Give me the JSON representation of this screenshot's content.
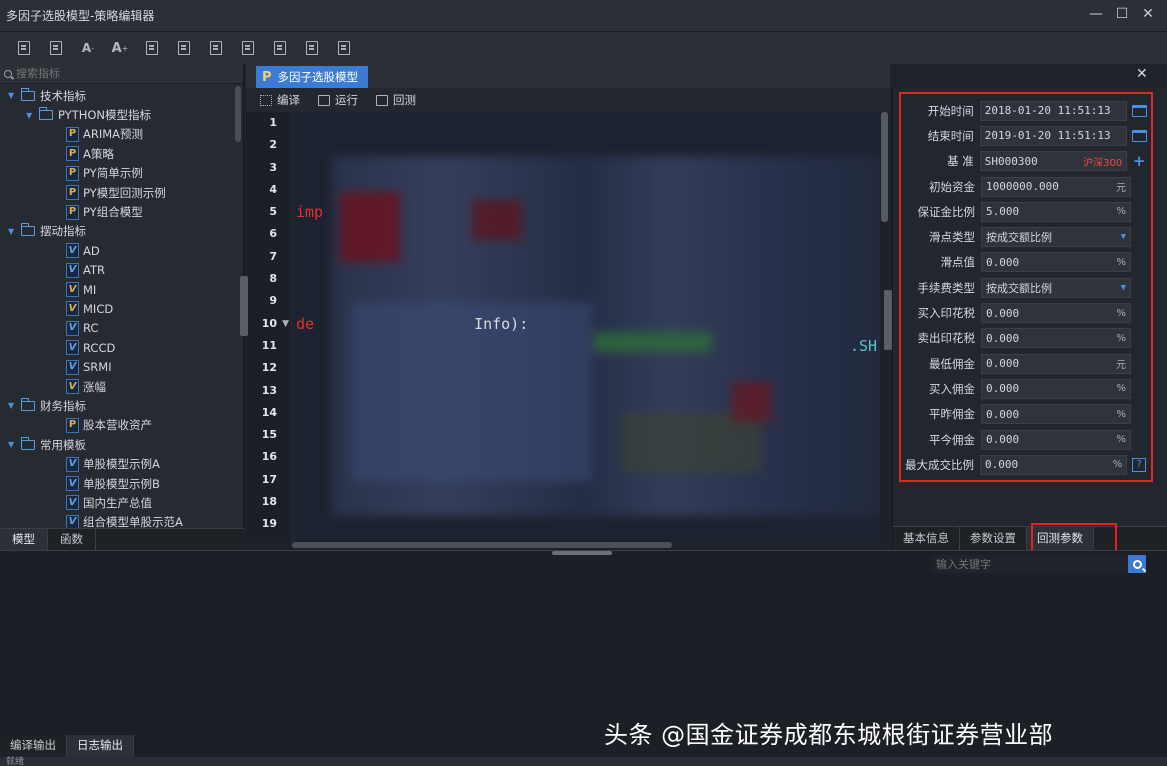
{
  "window": {
    "title": "多因子选股模型-策略编辑器",
    "controls": [
      "—",
      "☐",
      "✕"
    ]
  },
  "toolbar": {
    "buttons": [
      "new-file",
      "save",
      "font-decrease",
      "font-increase",
      "doc",
      "doc",
      "doc",
      "doc",
      "doc",
      "doc",
      "doc"
    ],
    "font_small_label": "A",
    "font_large_label": "A"
  },
  "left_panel": {
    "search_placeholder": "搜索指标",
    "tree": [
      {
        "type": "folder",
        "level": 0,
        "label": "技术指标"
      },
      {
        "type": "folder",
        "level": 1,
        "label": "PYTHON模型指标"
      },
      {
        "type": "leaf",
        "icon": "P",
        "label": "ARIMA预测"
      },
      {
        "type": "leaf",
        "icon": "P",
        "label": "A策略"
      },
      {
        "type": "leaf",
        "icon": "P",
        "label": "PY简单示例"
      },
      {
        "type": "leaf",
        "icon": "P",
        "label": "PY模型回测示例"
      },
      {
        "type": "leaf",
        "icon": "P",
        "label": "PY组合模型"
      },
      {
        "type": "folder",
        "level": 0,
        "label": "摆动指标"
      },
      {
        "type": "leaf",
        "icon": "V",
        "label": "AD"
      },
      {
        "type": "leaf",
        "icon": "V",
        "label": "ATR"
      },
      {
        "type": "leaf",
        "icon": "VS",
        "label": "MI"
      },
      {
        "type": "leaf",
        "icon": "VS",
        "label": "MICD"
      },
      {
        "type": "leaf",
        "icon": "V",
        "label": "RC"
      },
      {
        "type": "leaf",
        "icon": "V",
        "label": "RCCD"
      },
      {
        "type": "leaf",
        "icon": "V",
        "label": "SRMI"
      },
      {
        "type": "leaf",
        "icon": "VS",
        "label": "涨幅"
      },
      {
        "type": "folder",
        "level": 0,
        "label": "财务指标"
      },
      {
        "type": "leaf",
        "icon": "P",
        "label": "股本营收资产"
      },
      {
        "type": "folder",
        "level": 0,
        "label": "常用模板"
      },
      {
        "type": "leaf",
        "icon": "V",
        "label": "单股模型示例A"
      },
      {
        "type": "leaf",
        "icon": "V",
        "label": "单股模型示例B"
      },
      {
        "type": "leaf",
        "icon": "V",
        "label": "国内生产总值"
      },
      {
        "type": "leaf",
        "icon": "V",
        "label": "组合模型单股示范A"
      }
    ],
    "tabs": [
      "模型",
      "函数"
    ]
  },
  "editor": {
    "doc_tab": "多因子选股模型",
    "doc_tab_icon": "P",
    "close_label": "✕",
    "toolbar": [
      "编译",
      "运行",
      "回测"
    ],
    "line_numbers": [
      "1",
      "2",
      "3",
      "4",
      "5",
      "6",
      "7",
      "8",
      "9",
      "10",
      "11",
      "12",
      "13",
      "14",
      "15",
      "16",
      "17",
      "18",
      "19"
    ],
    "code_lines": [
      "",
      "",
      "",
      "",
      "imp",
      "",
      "",
      "",
      "",
      "de",
      "",
      "",
      "",
      "",
      "",
      "",
      "",
      "",
      ""
    ],
    "code_fragments": {
      "line10": "Info):",
      "line11": ".SH"
    }
  },
  "params": [
    {
      "label": "开始时间",
      "value": "2018-01-20 11:51:13",
      "extra": "calendar"
    },
    {
      "label": "结束时间",
      "value": "2019-01-20 11:51:13",
      "extra": "calendar"
    },
    {
      "label": "基    准",
      "value": "SH000300",
      "tag": "沪深300",
      "extra": "plus"
    },
    {
      "label": "初始资金",
      "value": "1000000.000",
      "unit": "元"
    },
    {
      "label": "保证金比例",
      "value": "5.000",
      "unit": "%"
    },
    {
      "label": "滑点类型",
      "value": "按成交额比例",
      "dropdown": true
    },
    {
      "label": "滑点值",
      "value": "0.000",
      "unit": "%"
    },
    {
      "label": "手续费类型",
      "value": "按成交额比例",
      "dropdown": true
    },
    {
      "label": "买入印花税",
      "value": "0.000",
      "unit": "%"
    },
    {
      "label": "卖出印花税",
      "value": "0.000",
      "unit": "%"
    },
    {
      "label": "最低佣金",
      "value": "0.000",
      "unit": "元"
    },
    {
      "label": "买入佣金",
      "value": "0.000",
      "unit": "%"
    },
    {
      "label": "平昨佣金",
      "value": "0.000",
      "unit": "%"
    },
    {
      "label": "平今佣金",
      "value": "0.000",
      "unit": "%"
    },
    {
      "label": "最大成交比例",
      "value": "0.000",
      "unit": "%",
      "extra": "help"
    }
  ],
  "right_tabs": [
    "基本信息",
    "参数设置",
    "回测参数"
  ],
  "bottom": {
    "search_placeholder": "输入关键字",
    "watermark": "头条 @国金证券成都东城根街证券营业部",
    "tabs": [
      "编译输出",
      "日志输出"
    ],
    "status": "就绪"
  },
  "colors": {
    "accent": "#3b7bd3",
    "highlight": "#e42323",
    "keyword": "#e0322c"
  }
}
